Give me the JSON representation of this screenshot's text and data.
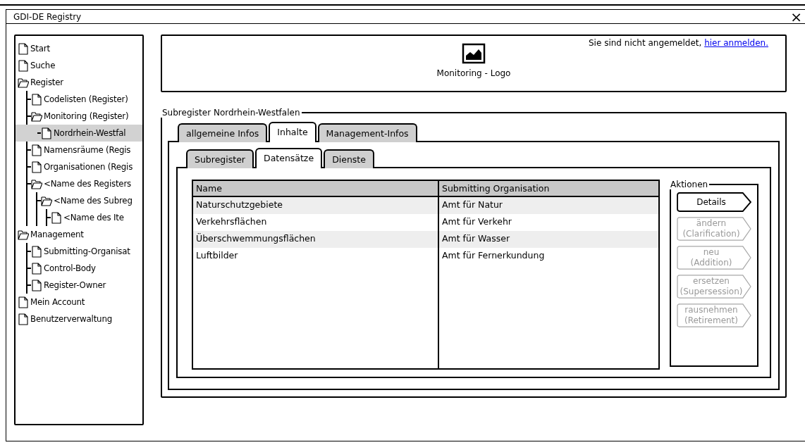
{
  "window": {
    "title": "GDI-DE Registry",
    "close": "×"
  },
  "sidebar": {
    "items": [
      {
        "label": "Start",
        "kind": "page",
        "selected": false
      },
      {
        "label": "Suche",
        "kind": "page",
        "selected": false
      },
      {
        "label": "Register",
        "kind": "folder",
        "selected": false,
        "children": [
          {
            "label": "Codelisten (Register)",
            "kind": "page",
            "selected": false
          },
          {
            "label": "Monitoring (Register)",
            "kind": "folder",
            "selected": false,
            "children": [
              {
                "label": "Nordrhein-Westfal",
                "kind": "page",
                "selected": true
              }
            ]
          },
          {
            "label": "Namensräume (Regis",
            "kind": "page",
            "selected": false
          },
          {
            "label": "Organisationen (Regis",
            "kind": "page",
            "selected": false
          },
          {
            "label": "<Name des Registers",
            "kind": "folder",
            "selected": false,
            "children": [
              {
                "label": "<Name des Subreg",
                "kind": "folder",
                "selected": false,
                "children": [
                  {
                    "label": "<Name des Ite",
                    "kind": "page",
                    "selected": false
                  }
                ]
              }
            ]
          }
        ]
      },
      {
        "label": "Management",
        "kind": "folder",
        "selected": false,
        "children": [
          {
            "label": "Submitting-Organisat",
            "kind": "page",
            "selected": false
          },
          {
            "label": "Control-Body",
            "kind": "page",
            "selected": false
          },
          {
            "label": "Register-Owner",
            "kind": "page",
            "selected": false
          }
        ]
      },
      {
        "label": "Mein Account",
        "kind": "page",
        "selected": false
      },
      {
        "label": "Benutzerverwaltung",
        "kind": "page",
        "selected": false
      }
    ]
  },
  "header": {
    "logo_caption": "Monitoring  - Logo",
    "login_text": "Sie sind nicht angemeldet,",
    "login_link": "hier anmelden."
  },
  "group": {
    "title": "Subregister Nordrhein-Westfalen",
    "tabs": [
      {
        "label": "allgemeine Infos",
        "selected": false
      },
      {
        "label": "Inhalte",
        "selected": true
      },
      {
        "label": "Management-Infos",
        "selected": false
      }
    ],
    "subtabs": [
      {
        "label": "Subregister",
        "selected": false
      },
      {
        "label": "Datensätze",
        "selected": true
      },
      {
        "label": "Dienste",
        "selected": false
      }
    ],
    "table": {
      "columns": [
        "Name",
        "Submitting Organisation"
      ],
      "rows": [
        {
          "cells": [
            "Naturschutzgebiete",
            "Amt für Natur"
          ]
        },
        {
          "cells": [
            "Verkehrsflächen",
            "Amt für Verkehr"
          ]
        },
        {
          "cells": [
            "Überschwemmungsflächen",
            "Amt für Wasser"
          ]
        },
        {
          "cells": [
            "Luftbilder",
            "Amt für Fernerkundung"
          ]
        }
      ]
    },
    "actions": {
      "title": "Aktionen",
      "buttons": [
        {
          "lines": [
            "Details"
          ],
          "disabled": false
        },
        {
          "lines": [
            "ändern",
            "(Clarification)"
          ],
          "disabled": true
        },
        {
          "lines": [
            "neu",
            "(Addition)"
          ],
          "disabled": true
        },
        {
          "lines": [
            "ersetzen",
            "(Supersession)"
          ],
          "disabled": true
        },
        {
          "lines": [
            "rausnehmen",
            "(Retirement)"
          ],
          "disabled": true
        }
      ]
    }
  }
}
